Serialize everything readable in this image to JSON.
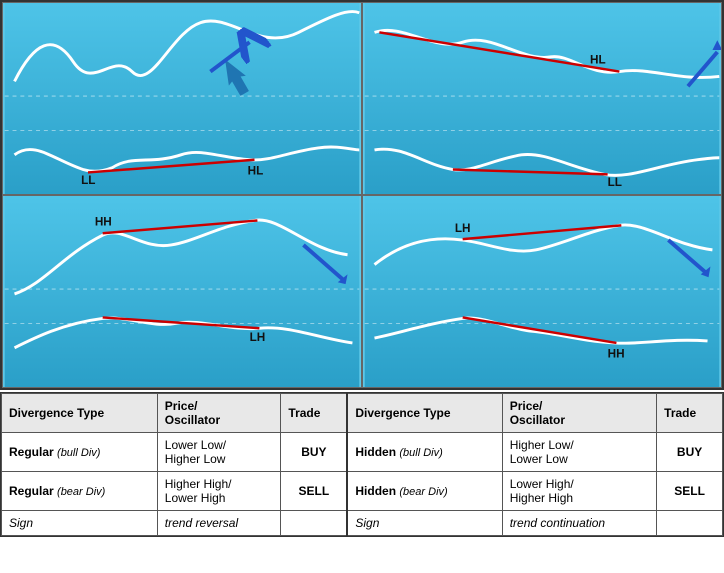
{
  "charts": [
    {
      "id": "top-left",
      "labels": [
        "LL",
        "HL"
      ],
      "direction": "bull",
      "position": "top-left"
    },
    {
      "id": "top-right",
      "labels": [
        "HL",
        "LL"
      ],
      "direction": "bull-hidden",
      "position": "top-right"
    },
    {
      "id": "bottom-left",
      "labels": [
        "HH",
        "LH"
      ],
      "direction": "bear",
      "position": "bottom-left"
    },
    {
      "id": "bottom-right",
      "labels": [
        "LH",
        "HH"
      ],
      "direction": "bear-hidden",
      "position": "bottom-right"
    }
  ],
  "table": {
    "headers": [
      "Divergence Type",
      "Price/\nOscillator",
      "Trade",
      "Divergence Type",
      "Price/\nOscillator",
      "Trade"
    ],
    "rows": [
      {
        "type1": "Regular",
        "type1_sub": "(bull Div)",
        "price1": "Lower Low/\nHigher Low",
        "trade1": "BUY",
        "type2": "Hidden",
        "type2_sub": "(bull Div)",
        "price2": "Higher Low/\nLower Low",
        "trade2": "BUY"
      },
      {
        "type1": "Regular",
        "type1_sub": "(bear Div)",
        "price1": "Higher High/\nLower High",
        "trade1": "SELL",
        "type2": "Hidden",
        "type2_sub": "(bear Div)",
        "price2": "Lower High/\nHigher High",
        "trade2": "SELL"
      },
      {
        "type1": "Sign",
        "type1_sub": "",
        "price1": "trend reversal",
        "trade1": "",
        "type2": "Sign",
        "type2_sub": "",
        "price2": "trend continuation",
        "trade2": ""
      }
    ]
  }
}
